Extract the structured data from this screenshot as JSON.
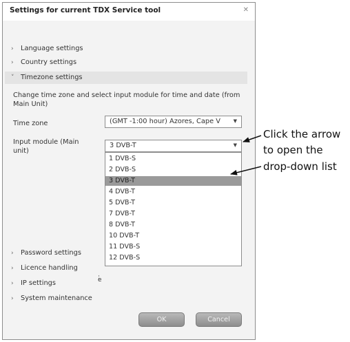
{
  "dialog": {
    "title": "Settings for current TDX Service tool",
    "close_glyph": "✕"
  },
  "sections_top": [
    {
      "label": "Language settings",
      "chevron": "›"
    },
    {
      "label": "Country settings",
      "chevron": "›"
    },
    {
      "label": "Timezone settings",
      "chevron": "˅"
    }
  ],
  "timezone": {
    "description": "Change time zone and select input module for time and date (from Main Unit)",
    "time_zone_label": "Time zone",
    "time_zone_value": "(GMT -1:00 hour) Azores, Cape V",
    "input_module_label": "Input module (Main unit)",
    "input_module_value": "3 DVB-T",
    "options": [
      "1 DVB-S",
      "2 DVB-S",
      "3 DVB-T",
      "4 DVB-T",
      "5 DVB-T",
      "7 DVB-T",
      "8 DVB-T",
      "10 DVB-T",
      "11 DVB-S",
      "12 DVB-S"
    ],
    "selected_index": 2
  },
  "sections_bottom": [
    {
      "label": "Password settings",
      "chevron": "›"
    },
    {
      "label": "Licence handling",
      "chevron": "›"
    },
    {
      "label": "IP settings",
      "chevron": "›"
    },
    {
      "label": "System maintenance",
      "chevron": "›"
    }
  ],
  "stray_marks": [
    ":",
    "e"
  ],
  "buttons": {
    "ok": "OK",
    "cancel": "Cancel"
  },
  "annotations": {
    "arrow_callout": [
      "Click the arrow",
      "to open the"
    ],
    "list_callout": "drop-down list"
  }
}
